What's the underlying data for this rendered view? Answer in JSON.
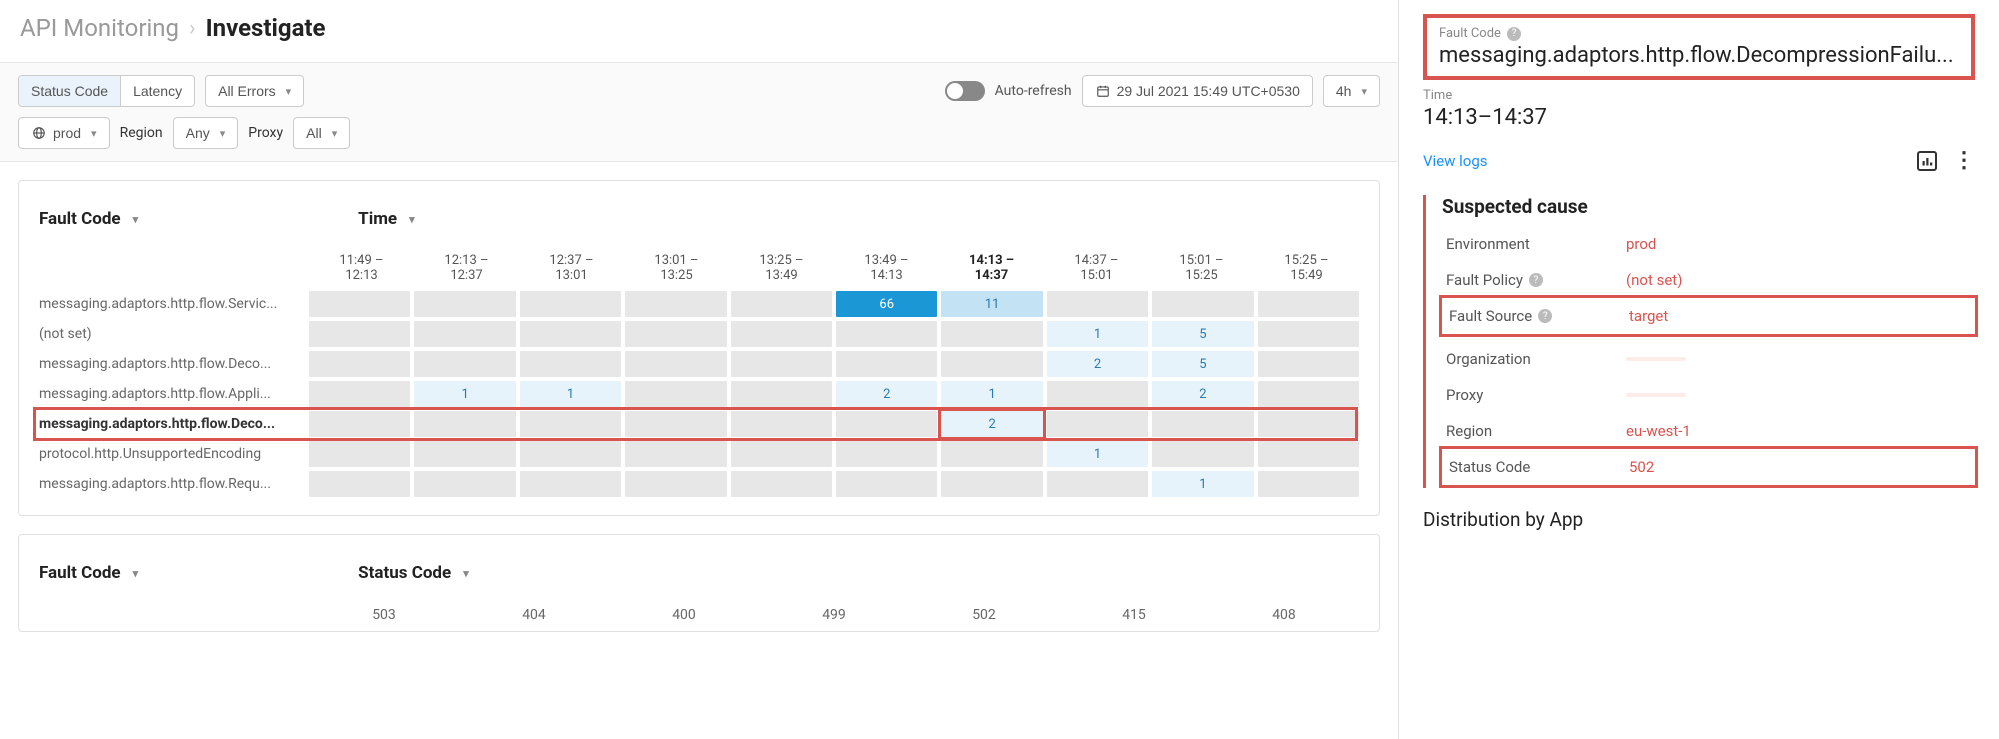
{
  "breadcrumb": {
    "root": "API Monitoring",
    "current": "Investigate"
  },
  "toolbar": {
    "status_code": "Status Code",
    "latency": "Latency",
    "all_errors": "All Errors",
    "auto_refresh": "Auto-refresh",
    "date": "29 Jul 2021 15:49 UTC+0530",
    "range": "4h",
    "env": "prod",
    "region_label": "Region",
    "region_any": "Any",
    "proxy": "Proxy",
    "proxy_all": "All"
  },
  "heat": {
    "row_dd": "Fault Code",
    "col_dd": "Time",
    "cols": [
      "11:49 – 12:13",
      "12:13 – 12:37",
      "12:37 – 13:01",
      "13:01 – 13:25",
      "13:25 – 13:49",
      "13:49 – 14:13",
      "14:13 – 14:37",
      "14:37 – 15:01",
      "15:01 – 15:25",
      "15:25 – 15:49"
    ],
    "selected_col": 6,
    "rows": [
      {
        "label": "messaging.adaptors.http.flow.Servic...",
        "cells": [
          "",
          "",
          "",
          "",
          "",
          "66",
          "11",
          "",
          "",
          ""
        ]
      },
      {
        "label": "(not set)",
        "cells": [
          "",
          "",
          "",
          "",
          "",
          "",
          "",
          "1",
          "5",
          ""
        ]
      },
      {
        "label": "messaging.adaptors.http.flow.Deco...",
        "cells": [
          "",
          "",
          "",
          "",
          "",
          "",
          "",
          "2",
          "5",
          ""
        ]
      },
      {
        "label": "messaging.adaptors.http.flow.Appli...",
        "cells": [
          "",
          "1",
          "1",
          "",
          "",
          "2",
          "1",
          "",
          "2",
          ""
        ]
      },
      {
        "label": "messaging.adaptors.http.flow.Deco...",
        "cells": [
          "",
          "",
          "",
          "",
          "",
          "",
          "2",
          "",
          "",
          ""
        ],
        "hl": true,
        "hl_cell": 6
      },
      {
        "label": "protocol.http.UnsupportedEncoding",
        "cells": [
          "",
          "",
          "",
          "",
          "",
          "",
          "",
          "1",
          "",
          ""
        ]
      },
      {
        "label": "messaging.adaptors.http.flow.Requ...",
        "cells": [
          "",
          "",
          "",
          "",
          "",
          "",
          "",
          "",
          "1",
          ""
        ]
      }
    ]
  },
  "chart2": {
    "row_dd": "Fault Code",
    "col_dd": "Status Code",
    "codes": [
      "503",
      "404",
      "400",
      "499",
      "502",
      "415",
      "408"
    ]
  },
  "side": {
    "fault_code_label": "Fault Code",
    "fault_code": "messaging.adaptors.http.flow.DecompressionFailu...",
    "time_label": "Time",
    "time_value": "14:13–14:37",
    "view_logs": "View logs",
    "suspected_title": "Suspected cause",
    "kv": [
      {
        "k": "Environment",
        "v": "prod"
      },
      {
        "k": "Fault Policy",
        "v": "(not set)",
        "q": true
      },
      {
        "k": "Fault Source",
        "v": "target",
        "q": true,
        "box": true
      },
      {
        "k": "Organization",
        "v": "",
        "red": true
      },
      {
        "k": "Proxy",
        "v": "",
        "red": true
      },
      {
        "k": "Region",
        "v": "eu-west-1"
      },
      {
        "k": "Status Code",
        "v": "502",
        "box": true
      }
    ],
    "dist_title": "Distribution by App"
  },
  "chart_data": {
    "type": "heatmap",
    "xlabel": "Time",
    "ylabel": "Fault Code",
    "x": [
      "11:49–12:13",
      "12:13–12:37",
      "12:37–13:01",
      "13:01–13:25",
      "13:25–13:49",
      "13:49–14:13",
      "14:13–14:37",
      "14:37–15:01",
      "15:01–15:25",
      "15:25–15:49"
    ],
    "y": [
      "messaging.adaptors.http.flow.Servic...",
      "(not set)",
      "messaging.adaptors.http.flow.Deco...",
      "messaging.adaptors.http.flow.Appli...",
      "messaging.adaptors.http.flow.Deco...",
      "protocol.http.UnsupportedEncoding",
      "messaging.adaptors.http.flow.Requ..."
    ],
    "values": [
      [
        null,
        null,
        null,
        null,
        null,
        66,
        11,
        null,
        null,
        null
      ],
      [
        null,
        null,
        null,
        null,
        null,
        null,
        null,
        1,
        5,
        null
      ],
      [
        null,
        null,
        null,
        null,
        null,
        null,
        null,
        2,
        5,
        null
      ],
      [
        null,
        1,
        1,
        null,
        null,
        2,
        1,
        null,
        2,
        null
      ],
      [
        null,
        null,
        null,
        null,
        null,
        null,
        2,
        null,
        null,
        null
      ],
      [
        null,
        null,
        null,
        null,
        null,
        null,
        null,
        1,
        null,
        null
      ],
      [
        null,
        null,
        null,
        null,
        null,
        null,
        null,
        null,
        1,
        null
      ]
    ]
  }
}
